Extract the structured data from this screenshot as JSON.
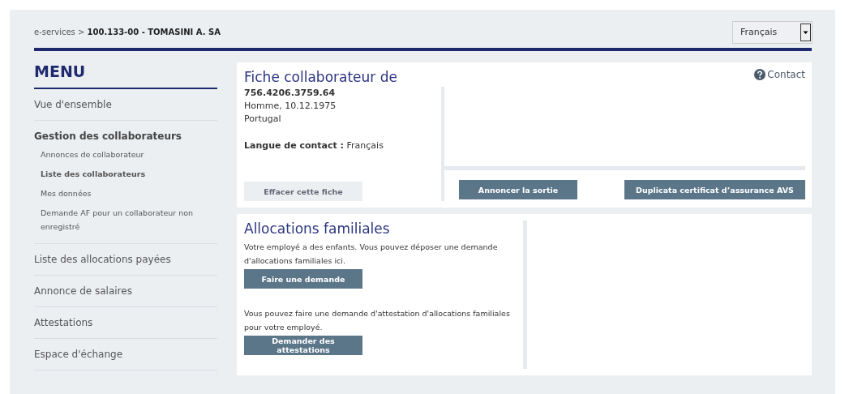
{
  "breadcrumb": {
    "root": "e-services >",
    "current": "100.133-00 - TOMASINI A. SA"
  },
  "language_select": {
    "value": "Français"
  },
  "menu": {
    "title": "MENU",
    "items": [
      {
        "label": "Vue d'ensemble",
        "expanded": false
      },
      {
        "label": "Gestion des collaborateurs",
        "expanded": true,
        "children": [
          {
            "label": "Annonces de collaborateur",
            "selected": false
          },
          {
            "label": "Liste des collaborateurs",
            "selected": true
          },
          {
            "label": "Mes données",
            "selected": false
          },
          {
            "label": "Demande AF pour un collaborateur non enregistré",
            "selected": false
          }
        ]
      },
      {
        "label": "Liste des allocations payées",
        "expanded": false
      },
      {
        "label": "Annonce de salaires",
        "expanded": false
      },
      {
        "label": "Attestations",
        "expanded": false
      },
      {
        "label": "Espace d'échange",
        "expanded": false
      }
    ]
  },
  "employee_card": {
    "title": "Fiche collaborateur de",
    "contact_link": "Contact",
    "ssn": "756.4206.3759.64",
    "details": "Homme, 10.12.1975",
    "country": "Portugal",
    "contact_language_label": "Langue de contact :",
    "contact_language": "Français",
    "delete_button": "Effacer cette fiche",
    "actions": [
      "Annoncer la sortie",
      "Duplicata certificat d’assurance AVS"
    ]
  },
  "family_allowances": {
    "title": "Allocations familiales",
    "sections": [
      {
        "text": "Votre employé a des enfants. Vous pouvez déposer une demande d'allocations familiales ici.",
        "button": "Faire une demande"
      },
      {
        "text": "Vous pouvez faire une demande d'attestation d'allocations familiales pour votre employé.",
        "button": "Demander des attestations"
      }
    ]
  }
}
